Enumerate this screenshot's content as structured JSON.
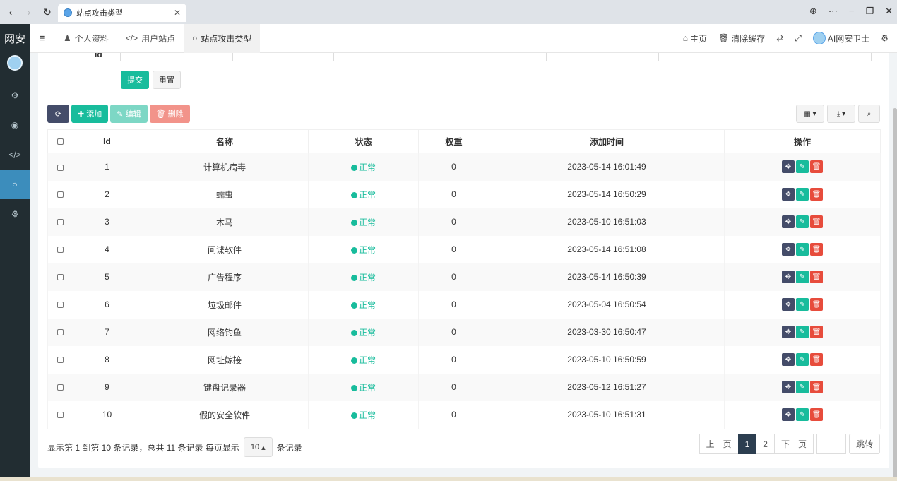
{
  "browser": {
    "tab_title": "站点攻击类型"
  },
  "sidebar": {
    "logo": "网安"
  },
  "header": {
    "tabs": [
      {
        "label": "个人资料",
        "icon": "user-icon"
      },
      {
        "label": "用户站点",
        "icon": "code-icon"
      },
      {
        "label": "站点攻击类型",
        "icon": "circle-icon"
      }
    ],
    "right": {
      "home": "主页",
      "clear_cache": "清除缓存",
      "ai_guard": "AI网安卫士"
    }
  },
  "form": {
    "buttons": {
      "submit": "提交",
      "reset": "重置"
    }
  },
  "toolbar": {
    "add": "添加",
    "edit": "编辑",
    "delete": "删除"
  },
  "table": {
    "headers": [
      "Id",
      "名称",
      "状态",
      "权重",
      "添加时间",
      "操作"
    ],
    "rows": [
      {
        "id": "1",
        "name": "计算机病毒",
        "status": "正常",
        "weight": "0",
        "time": "2023-05-14 16:01:49"
      },
      {
        "id": "2",
        "name": "蠕虫",
        "status": "正常",
        "weight": "0",
        "time": "2023-05-14 16:50:29"
      },
      {
        "id": "3",
        "name": "木马",
        "status": "正常",
        "weight": "0",
        "time": "2023-05-10 16:51:03"
      },
      {
        "id": "4",
        "name": "间谍软件",
        "status": "正常",
        "weight": "0",
        "time": "2023-05-14 16:51:08"
      },
      {
        "id": "5",
        "name": "广告程序",
        "status": "正常",
        "weight": "0",
        "time": "2023-05-14 16:50:39"
      },
      {
        "id": "6",
        "name": "垃圾邮件",
        "status": "正常",
        "weight": "0",
        "time": "2023-05-04 16:50:54"
      },
      {
        "id": "7",
        "name": "网络钓鱼",
        "status": "正常",
        "weight": "0",
        "time": "2023-03-30 16:50:47"
      },
      {
        "id": "8",
        "name": "网址嫁接",
        "status": "正常",
        "weight": "0",
        "time": "2023-05-10 16:50:59"
      },
      {
        "id": "9",
        "name": "键盘记录器",
        "status": "正常",
        "weight": "0",
        "time": "2023-05-12 16:51:27"
      },
      {
        "id": "10",
        "name": "假的安全软件",
        "status": "正常",
        "weight": "0",
        "time": "2023-05-10 16:51:31"
      }
    ]
  },
  "pagination": {
    "info_prefix": "显示第 1 到第 10 条记录，总共 11 条记录 每页显示",
    "page_size": "10",
    "info_suffix": "条记录",
    "prev": "上一页",
    "pages": [
      "1",
      "2"
    ],
    "current_page": "1",
    "next": "下一页",
    "jump": "跳转"
  },
  "colors": {
    "primary": "#18bc9c",
    "dark": "#444c69",
    "danger": "#e74c3c",
    "sidebar": "#222d32",
    "active_side": "#3c8dbc"
  }
}
